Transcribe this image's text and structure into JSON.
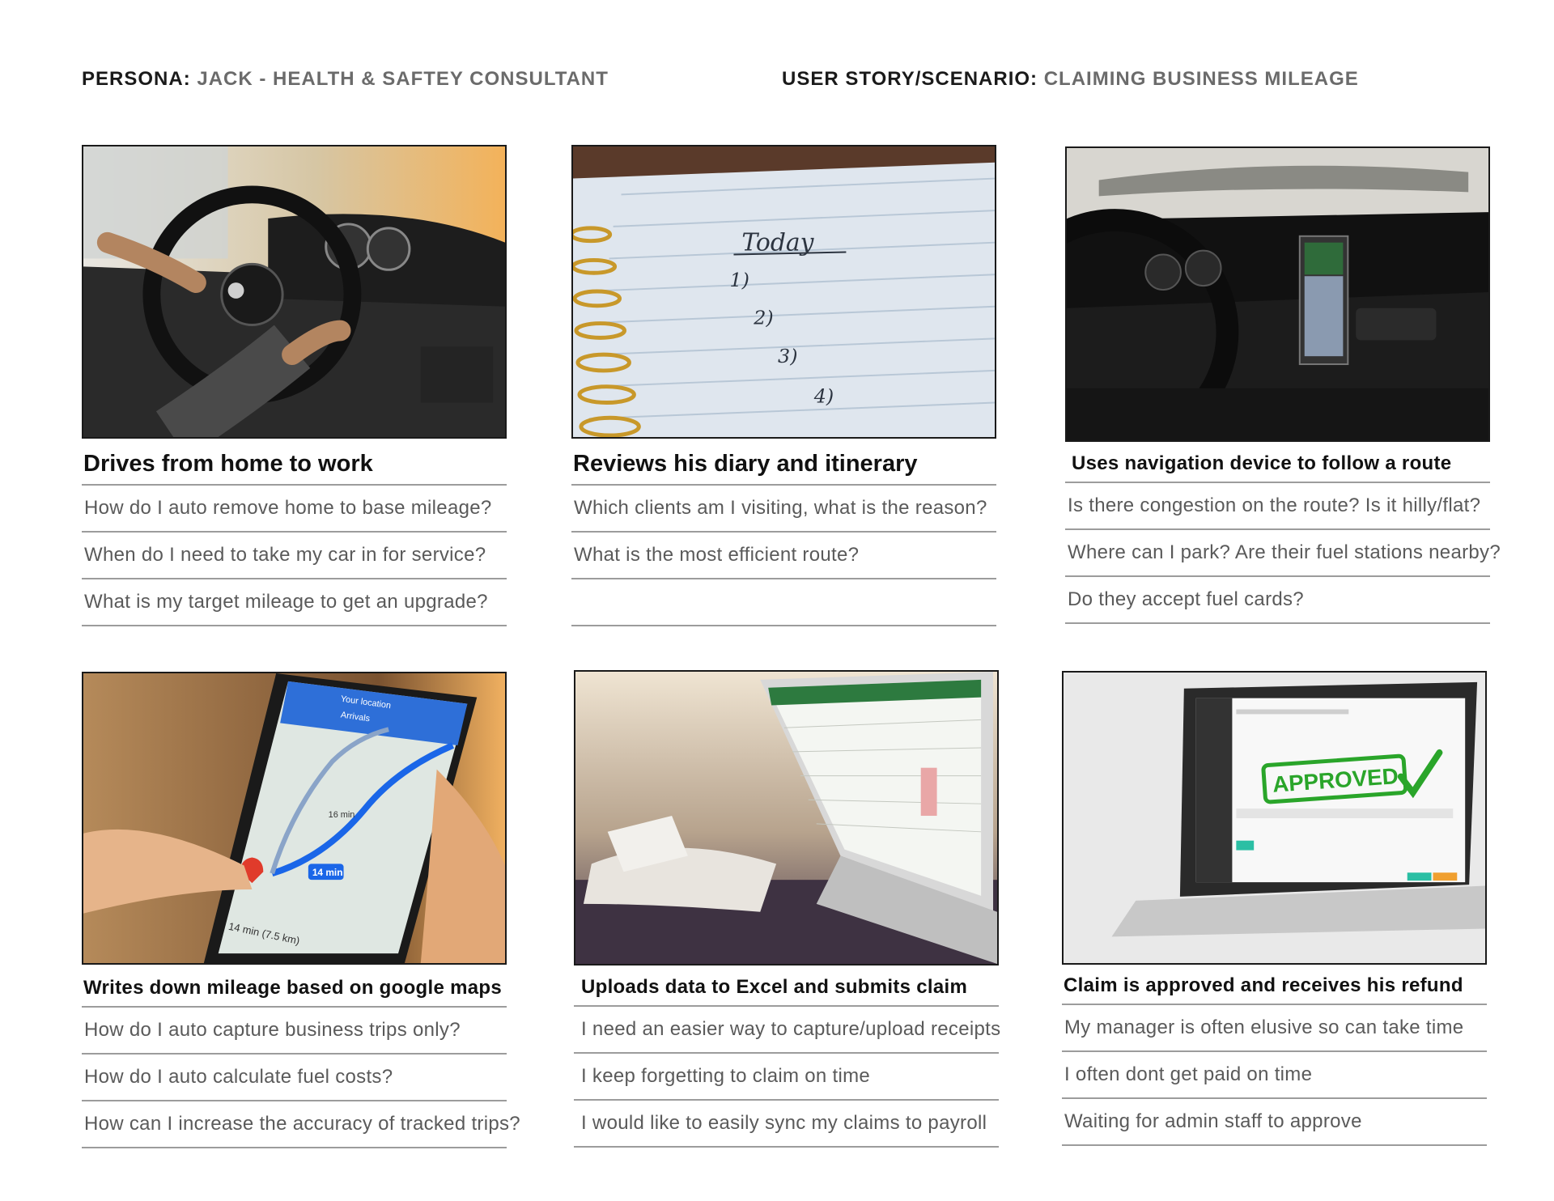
{
  "header": {
    "persona_key": "PERSONA:",
    "persona_value": "JACK - HEALTH & SAFTEY CONSULTANT",
    "story_key": "USER STORY/SCENARIO:",
    "story_value": "CLAIMING BUSINESS MILEAGE"
  },
  "cards": [
    {
      "title": "Drives from home to work",
      "questions": [
        "How do I auto remove home to base mileage?",
        "When do I need to take my car in for service?",
        "What is my target mileage to get an upgrade?"
      ]
    },
    {
      "title": "Reviews his diary and itinerary",
      "image_text": {
        "heading": "Today",
        "items": [
          "1)",
          "2)",
          "3)",
          "4)"
        ]
      },
      "questions": [
        "Which clients am I visiting, what is the reason?",
        "What is the most efficient route?",
        ""
      ]
    },
    {
      "title": "Uses navigation device to follow a  route",
      "questions": [
        "Is there congestion on the route? Is it hilly/flat?",
        "Where can I park? Are their fuel stations nearby?",
        "Do they accept fuel cards?"
      ]
    },
    {
      "title": "Writes down mileage based on google maps",
      "image_text": {
        "location": "Your location",
        "destination": "Arrivals",
        "route_time": "14 min",
        "alt_time": "16 min",
        "summary": "14 min (7.5 km)"
      },
      "questions": [
        "How do I auto capture business trips only?",
        "How do I auto calculate fuel costs?",
        "How can I increase the accuracy of tracked trips?"
      ]
    },
    {
      "title": "Uploads data to Excel and submits claim",
      "questions": [
        "I need an easier way to capture/upload receipts",
        "I keep forgetting to claim on time",
        "I would like to easily sync my claims to payroll"
      ]
    },
    {
      "title": "Claim is approved and receives his refund",
      "image_text": {
        "stamp": "APPROVED"
      },
      "questions": [
        "My manager is often elusive so can take time",
        "I often dont get paid on time",
        "Waiting for admin staff to approve"
      ]
    }
  ],
  "colors": {
    "header_key": "#1a1a1a",
    "header_value": "#6b6b6b",
    "question_text": "#5a5a5a",
    "rule": "#9c9c9c",
    "approved_green": "#2aa52a"
  }
}
